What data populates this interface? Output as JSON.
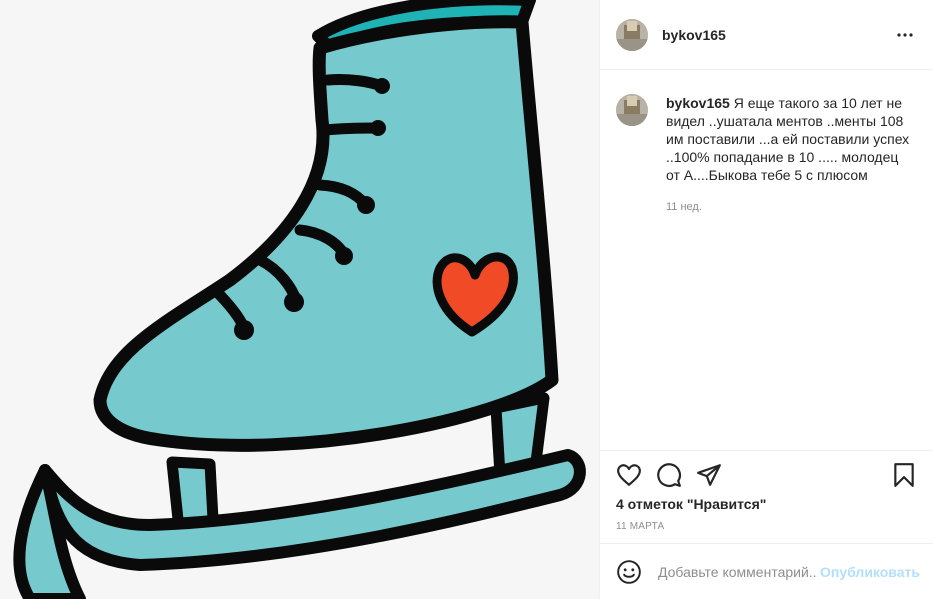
{
  "post": {
    "username": "bykov165",
    "more_icon": "more-horizontal-icon"
  },
  "comment": {
    "username": "bykov165",
    "text": "Я еще такого за 10 лет не видел ..ушатала ментов ..менты 108 им поставили ...а ей поставили успех ..100% попадание в 10 ..... молодец от А....Быкова тебе 5 с плюсом",
    "time_ago": "11 нед."
  },
  "actions": {
    "like_icon": "heart-icon",
    "comment_icon": "comment-icon",
    "share_icon": "share-icon",
    "save_icon": "bookmark-icon",
    "likes": "4 отметок \"Нравится\"",
    "date": "11 МАРТА"
  },
  "add_comment": {
    "placeholder": "Добавьте комментарий...",
    "publish_label": "Опубликовать",
    "emoji_icon": "smiley-icon"
  },
  "colors": {
    "skate_teal": "#76cacd",
    "skate_top": "#1fb3b5",
    "heart_red": "#f04a26",
    "outline": "#0a0a0a",
    "link_blue_disabled": "#b2dffc"
  }
}
